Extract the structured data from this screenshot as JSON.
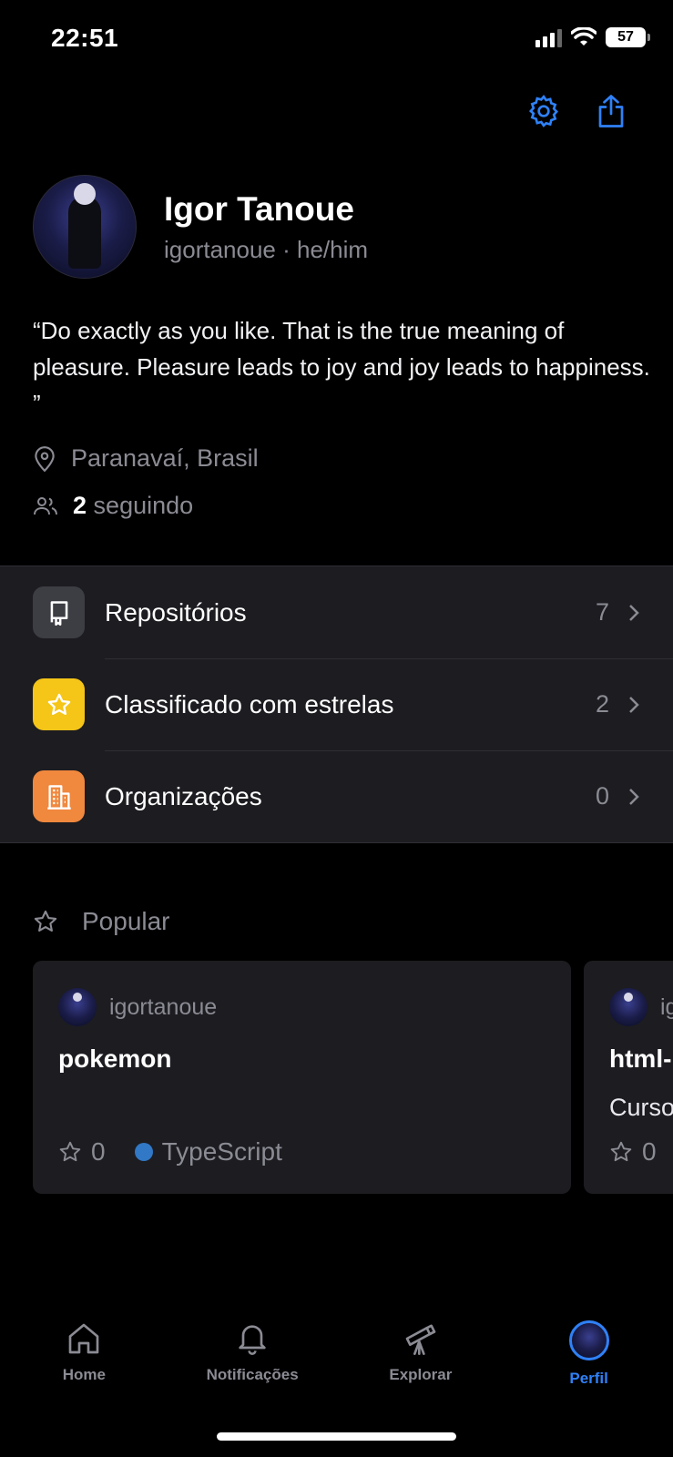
{
  "status": {
    "time": "22:51",
    "battery": "57"
  },
  "profile": {
    "name": "Igor Tanoue",
    "handle": "igortanoue · he/him",
    "bio": "“Do exactly as you like. That is the true meaning of pleasure. Pleasure leads to joy and joy leads to happiness. ”",
    "location": "Paranavaí, Brasil",
    "following_count": "2",
    "following_label": "seguindo"
  },
  "menu": {
    "items": [
      {
        "label": "Repositórios",
        "count": "7",
        "color": "#3d3d44"
      },
      {
        "label": "Classificado com estrelas",
        "count": "2",
        "color": "#f5c518"
      },
      {
        "label": "Organizações",
        "count": "0",
        "color": "#f0883e"
      }
    ]
  },
  "popular": {
    "title": "Popular",
    "cards": [
      {
        "owner": "igortanoue",
        "repo": "pokemon",
        "description": "",
        "stars": "0",
        "language": "TypeScript",
        "language_color": "#3178c6"
      },
      {
        "owner": "ig",
        "repo": "html-",
        "description": "Curso",
        "stars": "0"
      }
    ]
  },
  "tabs": [
    {
      "label": "Home",
      "icon": "home-icon"
    },
    {
      "label": "Notificações",
      "icon": "bell-icon"
    },
    {
      "label": "Explorar",
      "icon": "telescope-icon"
    },
    {
      "label": "Perfil",
      "icon": "avatar"
    }
  ],
  "colors": {
    "accent": "#2f81f7",
    "background": "#000000",
    "surface": "#1c1c21"
  }
}
